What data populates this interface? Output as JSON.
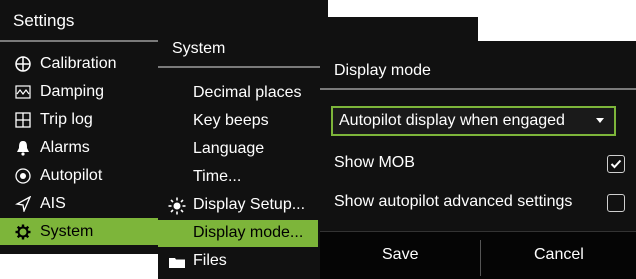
{
  "settings": {
    "title": "Settings",
    "items": [
      {
        "label": "Calibration",
        "icon": "calibration-icon"
      },
      {
        "label": "Damping",
        "icon": "damping-icon"
      },
      {
        "label": "Trip log",
        "icon": "trip-log-icon"
      },
      {
        "label": "Alarms",
        "icon": "bell-icon"
      },
      {
        "label": "Autopilot",
        "icon": "autopilot-icon"
      },
      {
        "label": "AIS",
        "icon": "ais-icon"
      },
      {
        "label": "System",
        "icon": "gear-icon",
        "selected": true
      }
    ]
  },
  "system": {
    "title": "System",
    "items": [
      {
        "label": "Decimal places"
      },
      {
        "label": "Key beeps"
      },
      {
        "label": "Language"
      },
      {
        "label": "Time..."
      },
      {
        "label": "Display Setup...",
        "icon": "sun-icon"
      },
      {
        "label": "Display mode...",
        "selected": true
      },
      {
        "label": "Files",
        "icon": "folder-icon"
      }
    ]
  },
  "display_mode": {
    "title": "Display mode",
    "dropdown_value": "Autopilot display when engaged",
    "show_mob_label": "Show MOB",
    "show_mob_checked": true,
    "show_ap_label": "Show autopilot advanced settings",
    "show_ap_checked": false,
    "save_label": "Save",
    "cancel_label": "Cancel"
  },
  "colors": {
    "accent": "#7db53a",
    "panel_bg": "#111111",
    "text": "#ffffff"
  }
}
